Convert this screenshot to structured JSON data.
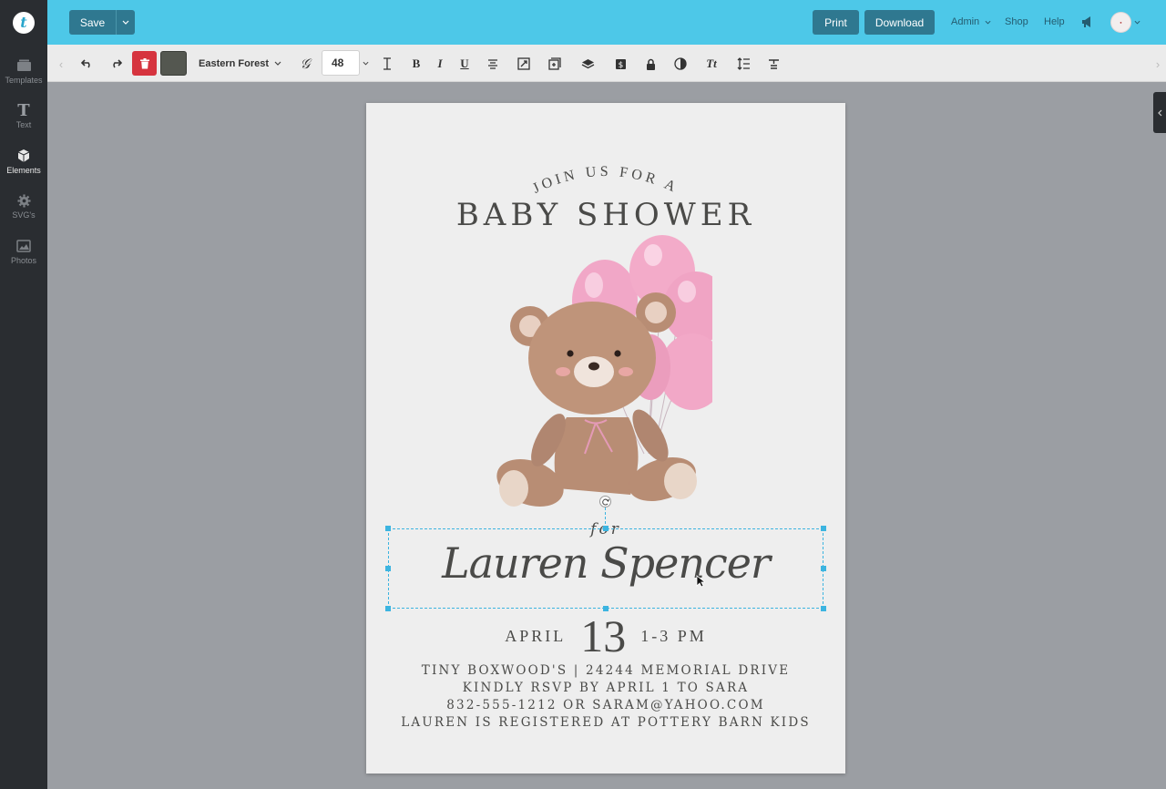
{
  "topbar": {
    "logo_letter": "t",
    "save_label": "Save",
    "print_label": "Print",
    "download_label": "Download",
    "admin_label": "Admin",
    "shop_label": "Shop",
    "help_label": "Help",
    "accent_color": "#4dc8e8",
    "button_color": "#2f7890"
  },
  "sidebar": {
    "items": [
      {
        "label": "Templates",
        "icon": "templates-icon"
      },
      {
        "label": "Text",
        "icon": "text-icon"
      },
      {
        "label": "Elements",
        "icon": "elements-icon",
        "active": true
      },
      {
        "label": "SVG's",
        "icon": "gear-icon"
      },
      {
        "label": "Photos",
        "icon": "photos-icon"
      }
    ]
  },
  "toolbar": {
    "font_name": "Eastern Forest",
    "font_size": "48",
    "swatch_color": "#545750",
    "bold_label": "B",
    "italic_label": "I",
    "underline_label": "U",
    "case_label": "Tt"
  },
  "invitation": {
    "arc_text": "JOIN US FOR A",
    "title": "BABY SHOWER",
    "for_text": "for",
    "name": "Lauren Spencer",
    "month": "APRIL",
    "day": "13",
    "time": "1-3 PM",
    "details": [
      "TINY BOXWOOD'S | 24244 MEMORIAL DRIVE",
      "KINDLY RSVP BY APRIL 1 TO SARA",
      "832-555-1212 OR SARAM@YAHOO.COM",
      "LAUREN IS REGISTERED AT POTTERY BARN KIDS"
    ],
    "balloon_color": "#f1a7c7",
    "bear_color": "#b88d74"
  }
}
